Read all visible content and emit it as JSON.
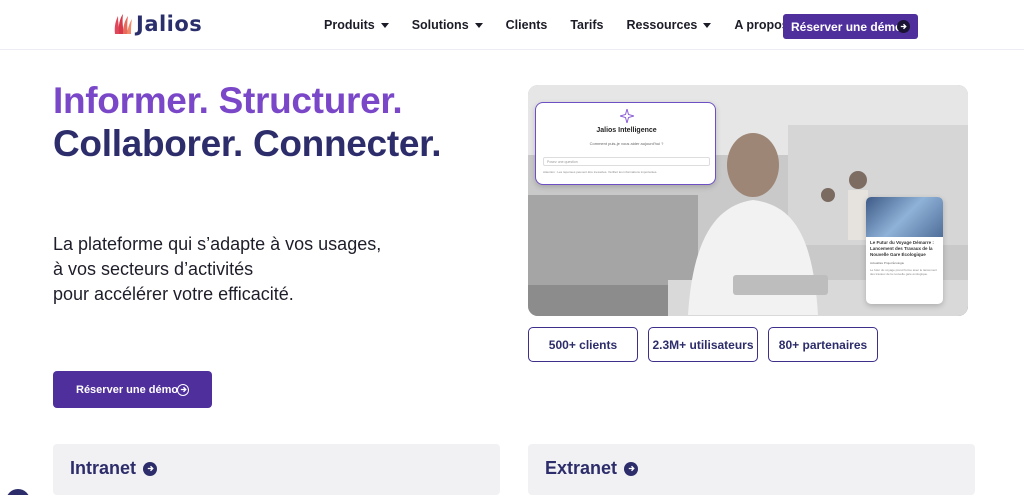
{
  "brand": {
    "name": "Jalios",
    "logo_color": "#2a2f6b",
    "flame_color": "#d63a4a"
  },
  "nav": {
    "items": [
      {
        "label": "Produits",
        "dropdown": true
      },
      {
        "label": "Solutions",
        "dropdown": true
      },
      {
        "label": "Clients",
        "dropdown": false
      },
      {
        "label": "Tarifs",
        "dropdown": false
      },
      {
        "label": "Ressources",
        "dropdown": true
      },
      {
        "label": "A propos",
        "dropdown": true
      }
    ],
    "cta_label": "Réserver une démo"
  },
  "hero": {
    "headline_line1": "Informer. Structurer.",
    "headline_line2": "Collaborer. Connecter.",
    "subtitle": [
      "La plateforme qui s’adapte à vos usages,",
      "à vos secteurs d’activités",
      "pour accélérer votre efficacité."
    ],
    "cta_label": "Réserver une démo"
  },
  "ai_card": {
    "title": "Jalios Intelligence",
    "subtitle": "Comment puis-je vous aider aujourd'hui ?",
    "placeholder": "Posez une question",
    "note": "Attention : Les réponses peuvent être inexactes. Vérifiez les informations importantes."
  },
  "news_card": {
    "title": "Le Futur du Voyage Démarre : Lancement des Travaux de la Nouvelle Gare Écologique",
    "tags": [
      "Actualités",
      "Projet",
      "Écologie"
    ],
    "body": "Le futur du voyage prend forme avec le lancement des travaux de la nouvelle gare écologique."
  },
  "stats": [
    "500+ clients",
    "2.3M+ utilisateurs",
    "80+ partenaires"
  ],
  "cards": [
    {
      "title": "Intranet"
    },
    {
      "title": "Extranet"
    }
  ],
  "colors": {
    "primary": "#4f2f9c",
    "headline_purple": "#7a47c8",
    "navy": "#2d2d6b"
  }
}
